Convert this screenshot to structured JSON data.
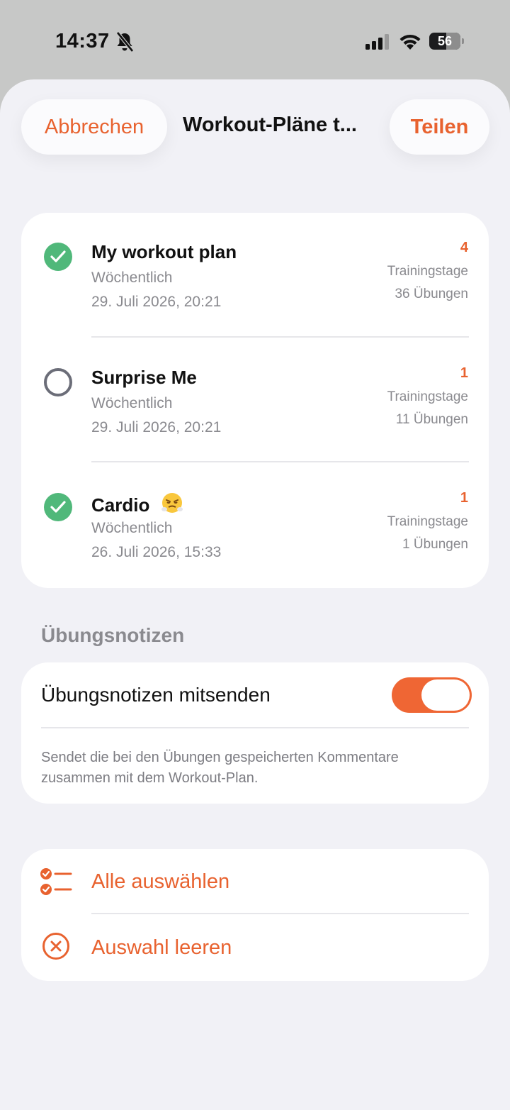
{
  "status_bar": {
    "time": "14:37",
    "battery": "56"
  },
  "nav": {
    "cancel_label": "Abbrechen",
    "title": "Workout-Pläne t...",
    "share_label": "Teilen"
  },
  "plans": [
    {
      "name": "My workout plan",
      "selected": true,
      "frequency": "Wöchentlich",
      "date": "29. Juli 2026, 20:21",
      "days": "4",
      "days_label": "Trainingstage",
      "exercises": "36 Übungen"
    },
    {
      "name": "Surprise Me",
      "selected": false,
      "frequency": "Wöchentlich",
      "date": "29. Juli 2026, 20:21",
      "days": "1",
      "days_label": "Trainingstage",
      "exercises": "11 Übungen"
    },
    {
      "name": "Cardio",
      "emoji": "face-with-steam-icon",
      "selected": true,
      "frequency": "Wöchentlich",
      "date": "26. Juli 2026, 15:33",
      "days": "1",
      "days_label": "Trainingstage",
      "exercises": "1 Übungen"
    }
  ],
  "notes_section": {
    "title": "Übungsnotizen",
    "toggle_label": "Übungsnotizen mitsenden",
    "toggle_on": true,
    "description": "Sendet die bei den Übungen gespeicherten Kommentare zusammen mit dem Workout-Plan."
  },
  "actions": {
    "select_all_label": "Alle auswählen",
    "clear_selection_label": "Auswahl leeren"
  },
  "colors": {
    "accent": "#e8622f",
    "check_green": "#50b87a",
    "sheet_background": "#f1f1f6"
  }
}
